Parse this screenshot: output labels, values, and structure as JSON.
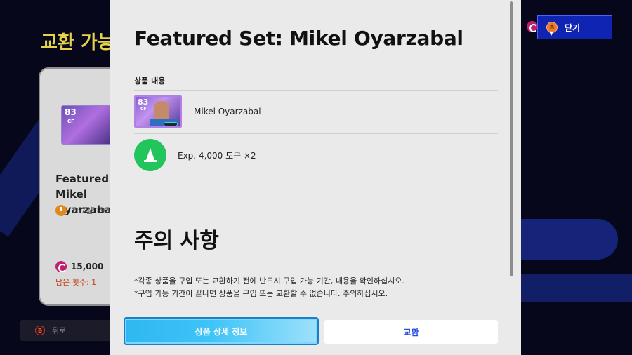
{
  "background": {
    "title": "교환 가능",
    "card": {
      "rating": "83",
      "position": "CF",
      "name": "Featured Set: Mikel Oyarzabal",
      "time_left": "167일 19시",
      "price": "15,000",
      "remaining": "남은 횟수: 1"
    },
    "back_label": "뒤로"
  },
  "close_button": {
    "key": "B",
    "label": "닫기"
  },
  "modal": {
    "title": "Featured Set: Mikel Oyarzabal",
    "contents_label": "상품 내용",
    "items": [
      {
        "rating": "83",
        "position": "CF",
        "name": "Mikel Oyarzabal",
        "icon": "player-card-icon"
      },
      {
        "name": "Exp. 4,000 토큰 ×2",
        "icon": "training-cone-icon"
      }
    ],
    "notice_title": "주의 사항",
    "notice_lines": [
      "*각종 상품을 구입 또는 교환하기 전에 반드시 구입 가능 기간, 내용을 확인하십시오.",
      "*구입 가능 기간이 끝나면 상품을 구입 또는 교환할 수 없습니다. 주의하십시오."
    ],
    "buttons": {
      "detail": "상품 상세 정보",
      "exchange": "교환"
    }
  },
  "colors": {
    "accent_blue": "#0f24b3",
    "title_yellow": "#e7d24a",
    "cone_green": "#22c45c",
    "coin_magenta": "#c21e6e"
  }
}
